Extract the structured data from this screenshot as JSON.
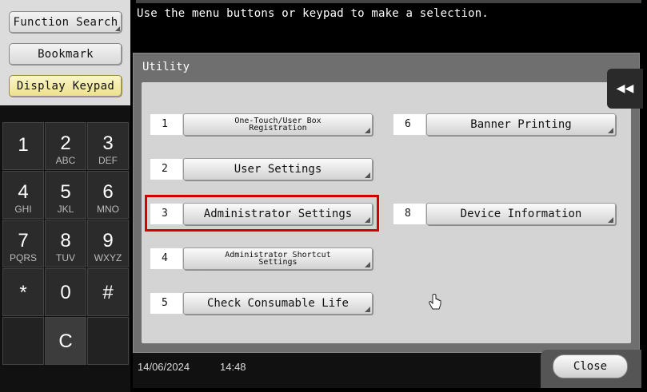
{
  "sidebar": {
    "function_search_label": "Function Search",
    "bookmark_label": "Bookmark",
    "display_keypad_label": "Display Keypad"
  },
  "keypad": {
    "keys": [
      {
        "num": "1",
        "letters": ""
      },
      {
        "num": "2",
        "letters": "ABC"
      },
      {
        "num": "3",
        "letters": "DEF"
      },
      {
        "num": "4",
        "letters": "GHI"
      },
      {
        "num": "5",
        "letters": "JKL"
      },
      {
        "num": "6",
        "letters": "MNO"
      },
      {
        "num": "7",
        "letters": "PQRS"
      },
      {
        "num": "8",
        "letters": "TUV"
      },
      {
        "num": "9",
        "letters": "WXYZ"
      },
      {
        "num": "*",
        "letters": ""
      },
      {
        "num": "0",
        "letters": ""
      },
      {
        "num": "#",
        "letters": ""
      },
      {
        "num": "C",
        "letters": ""
      }
    ]
  },
  "message": "Use the menu buttons or keypad to make a selection.",
  "utility": {
    "title": "Utility",
    "items": [
      {
        "number": "1",
        "label_line1": "One-Touch/User Box",
        "label_line2": "Registration"
      },
      {
        "number": "2",
        "label": "User Settings"
      },
      {
        "number": "3",
        "label": "Administrator Settings"
      },
      {
        "number": "4",
        "label_line1": "Administrator Shortcut",
        "label_line2": "Settings"
      },
      {
        "number": "5",
        "label": "Check Consumable Life"
      },
      {
        "number": "6",
        "label": "Banner Printing"
      },
      {
        "number": "8",
        "label": "Device Information"
      }
    ]
  },
  "back_icon": "double-left-arrow-icon",
  "footer": {
    "date": "14/06/2024",
    "time": "14:48",
    "close_label": "Close"
  },
  "colors": {
    "highlight": "#d40000"
  }
}
